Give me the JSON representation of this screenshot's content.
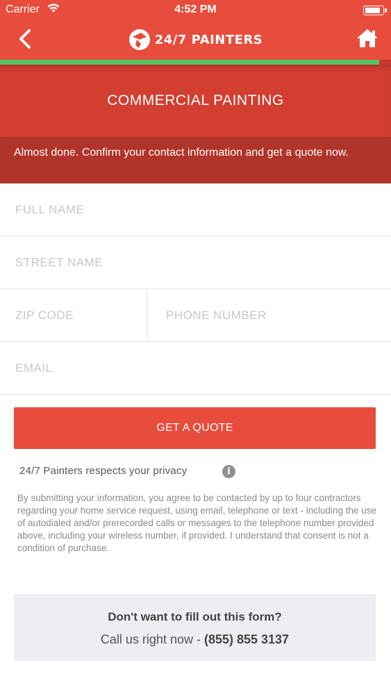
{
  "status_bar": {
    "carrier": "Carrier",
    "time": "4:52 PM",
    "battery_level": 0.9
  },
  "header": {
    "brand": "24/7 PAINTERS",
    "back_icon": "chevron-left-icon",
    "home_icon": "home-icon",
    "progress": 0.97
  },
  "hero": {
    "title": "COMMERCIAL PAINTING"
  },
  "notice": {
    "text": "Almost done. Confirm your contact information and get a quote now."
  },
  "form": {
    "full_name": {
      "placeholder": "FULL NAME",
      "value": ""
    },
    "street_name": {
      "placeholder": "STREET NAME",
      "value": ""
    },
    "zip_code": {
      "placeholder": "ZIP CODE",
      "value": ""
    },
    "phone_number": {
      "placeholder": "PHONE NUMBER",
      "value": ""
    },
    "email": {
      "placeholder": "EMAIL",
      "value": ""
    },
    "submit_label": "GET A QUOTE"
  },
  "privacy": {
    "text": "24/7 Painters respects your privacy",
    "icon": "info-icon"
  },
  "legal": {
    "text": "By submitting your information, you agree to be contacted by up to four contractors regarding your home service request, using email, telephone or text - including the use of autodialed and/or prerecorded calls or messages to the telephone number provided above, including your wireless number, if provided. I understand that consent is not a condition of purchase."
  },
  "callout": {
    "title": "Don't want to fill out this form?",
    "prefix": "Call us right now - ",
    "phone": "(855) 855 3137"
  },
  "colors": {
    "primary": "#e84c3d",
    "hero": "#d23e30",
    "notice": "#b1342a",
    "progress": "#57c35f",
    "callout_bg": "#ededf2"
  }
}
